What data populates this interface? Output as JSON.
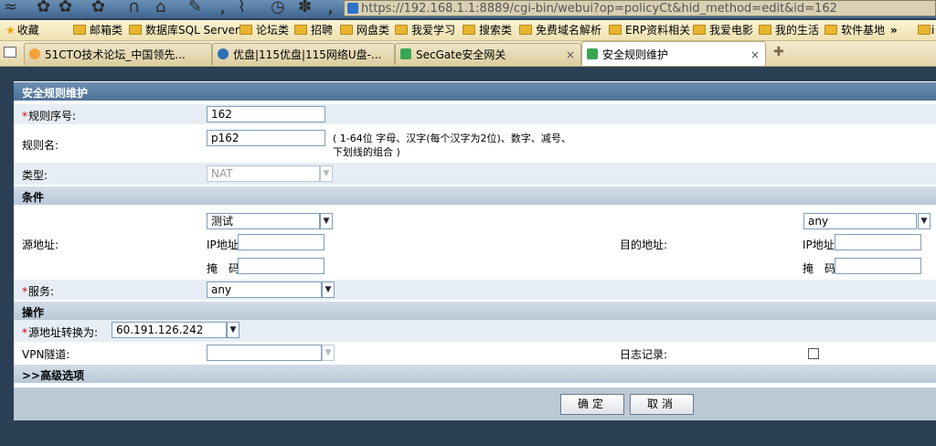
{
  "browser": {
    "address": "https://192.168.1.1:8889/cgi-bin/webui?op=policyCt&hid_method=edit&id=162",
    "toolbar_deco": [
      "≈",
      "✿",
      "∩",
      "⌂",
      "✎",
      ",",
      "⌇",
      "◷",
      "✽",
      ","
    ],
    "bookmarks": [
      {
        "label": "收藏",
        "icon": "star-icon"
      },
      {
        "label": "邮箱类",
        "icon": "folder-icon"
      },
      {
        "label": "数据库SQL Server",
        "icon": "folder-icon"
      },
      {
        "label": "论坛类",
        "icon": "folder-icon"
      },
      {
        "label": "招聘",
        "icon": "folder-icon"
      },
      {
        "label": "网盘类",
        "icon": "folder-icon"
      },
      {
        "label": "我爱学习",
        "icon": "folder-icon"
      },
      {
        "label": "搜索类",
        "icon": "folder-icon"
      },
      {
        "label": "免费域名解析",
        "icon": "folder-icon"
      },
      {
        "label": "ERP资料相关",
        "icon": "folder-icon"
      },
      {
        "label": "我爱电影",
        "icon": "folder-icon"
      },
      {
        "label": "我的生活",
        "icon": "folder-icon"
      },
      {
        "label": "软件基地",
        "icon": "folder-icon"
      }
    ],
    "bookmarks_more": "»",
    "bookmarks_tail": "i",
    "tabs": [
      {
        "label": "51CTO技术论坛_中国领先...",
        "icon_color": "#f2a23a",
        "close": "×"
      },
      {
        "label": "优盘|115优盘|115网络U盘-...",
        "icon_color": "#2f6fb5",
        "close": "×"
      },
      {
        "label": "SecGate安全网关",
        "icon_color": "#3aa655",
        "close": "×"
      },
      {
        "label": "安全规则维护",
        "icon_color": "#3aa655",
        "close": "×"
      }
    ],
    "new_tab": "✚"
  },
  "form": {
    "title": "安全规则维护",
    "rule_no": {
      "label": "规则序号:",
      "required": "*",
      "value": "162"
    },
    "rule_name": {
      "label": "规则名:",
      "value": "p162",
      "hint_line1": "( 1-64位 字母、汉字(每个汉字为2位)、数字、减号、",
      "hint_line2": "下划线的组合 )"
    },
    "type": {
      "label": "类型:",
      "value": "NAT"
    },
    "conditions": {
      "section": "条件",
      "src_label": "源地址:",
      "src_select": "测试",
      "src_ip_label": "IP地址",
      "src_mask_label": "掩　码",
      "dst_label": "目的地址:",
      "dst_select": "any",
      "dst_ip_label": "IP地址",
      "dst_mask_label": "掩　码"
    },
    "service": {
      "label": "服务:",
      "required": "*",
      "value": "any"
    },
    "actions": {
      "section": "操作",
      "snat_label": "源地址转换为:",
      "snat_required": "*",
      "snat_value": "60.191.126.242",
      "vpn_label": "VPN隧道:",
      "vpn_value": "",
      "log_label": "日志记录:"
    },
    "advanced": ">>高级选项",
    "dropdown_arrow": "▼",
    "buttons": {
      "ok": "确定",
      "cancel": "取消"
    }
  }
}
